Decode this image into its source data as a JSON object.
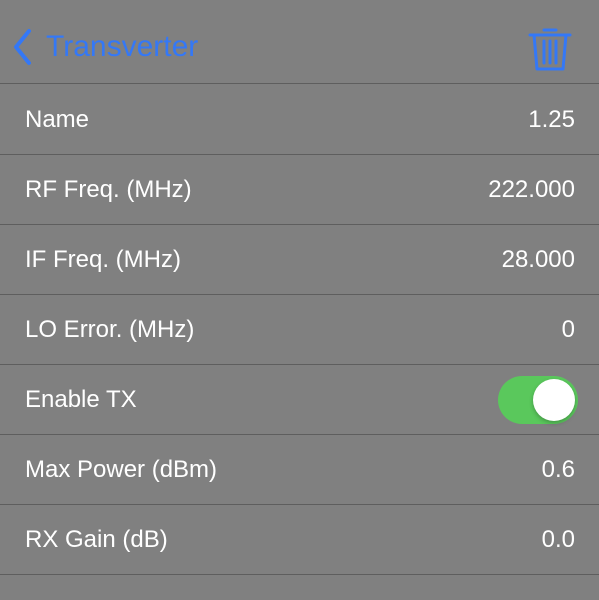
{
  "nav": {
    "title": "Transverter",
    "back_icon": "chevron-left-icon",
    "delete_icon": "trash-icon",
    "accent_color": "#3478f6"
  },
  "rows": [
    {
      "label": "Name",
      "value": "1.25"
    },
    {
      "label": "RF Freq. (MHz)",
      "value": "222.000"
    },
    {
      "label": "IF Freq. (MHz)",
      "value": "28.000"
    },
    {
      "label": "LO Error. (MHz)",
      "value": "0"
    },
    {
      "label": "Enable TX",
      "toggle_on": true,
      "toggle_color": "#5ac85c"
    },
    {
      "label": "Max Power (dBm)",
      "value": "0.6"
    },
    {
      "label": "RX Gain (dB)",
      "value": "0.0"
    }
  ]
}
